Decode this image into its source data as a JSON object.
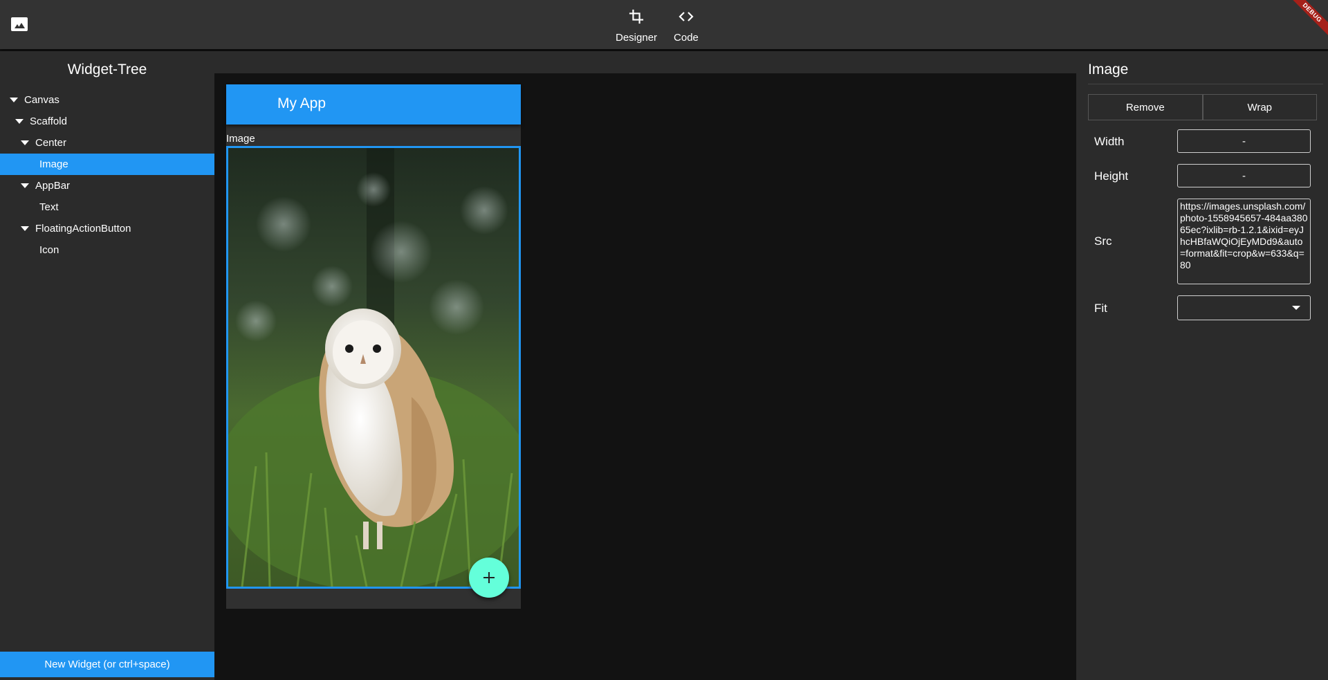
{
  "topbar": {
    "modes": [
      {
        "label": "Designer",
        "icon": "crop-icon"
      },
      {
        "label": "Code",
        "icon": "code-icon"
      }
    ],
    "debug_banner": "DEBUG"
  },
  "widget_tree": {
    "title": "Widget-Tree",
    "nodes": [
      {
        "label": "Canvas",
        "expanded": true,
        "selected": false
      },
      {
        "label": "Scaffold",
        "expanded": true,
        "selected": false
      },
      {
        "label": "Center",
        "expanded": true,
        "selected": false
      },
      {
        "label": "Image",
        "expanded": false,
        "selected": true
      },
      {
        "label": "AppBar",
        "expanded": true,
        "selected": false
      },
      {
        "label": "Text",
        "expanded": false,
        "selected": false
      },
      {
        "label": "FloatingActionButton",
        "expanded": true,
        "selected": false
      },
      {
        "label": "Icon",
        "expanded": false,
        "selected": false
      }
    ],
    "new_widget_button": "New Widget (or ctrl+space)"
  },
  "preview": {
    "appbar_title": "My App",
    "image_label": "Image",
    "fab_icon": "add-icon",
    "accent": "#2196f3",
    "fab_color": "#64ffda"
  },
  "properties": {
    "title": "Image",
    "remove_label": "Remove",
    "wrap_label": "Wrap",
    "width": {
      "label": "Width",
      "value": "-"
    },
    "height": {
      "label": "Height",
      "value": "-"
    },
    "src": {
      "label": "Src",
      "value": "https://images.unsplash.com/photo-1558945657-484aa38065ec?ixlib=rb-1.2.1&ixid=eyJhcHBfaWQiOjEyMDd9&auto=format&fit=crop&w=633&q=80"
    },
    "fit": {
      "label": "Fit",
      "value": ""
    }
  }
}
